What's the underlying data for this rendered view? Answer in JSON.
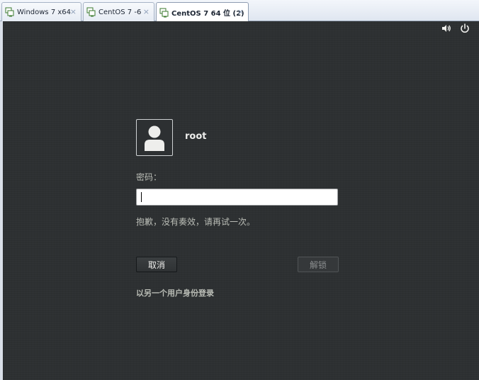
{
  "tabs": [
    {
      "label": "Windows 7 x64",
      "active": false
    },
    {
      "label": "CentOS 7 -6",
      "active": false
    },
    {
      "label": "CentOS 7 64 位 (2)",
      "active": true
    }
  ],
  "tab_close_glyph": "×",
  "topbar": {
    "volume_icon": "volume-icon",
    "power_icon": "power-icon"
  },
  "login": {
    "username": "root",
    "password_label": "密码：",
    "password_value": "",
    "error_message": "抱歉，没有奏效，请再试一次。",
    "cancel_label": "取消",
    "unlock_label": "解锁",
    "other_user_link": "以另一个用户身份登录"
  },
  "colors": {
    "background": "#2d3032",
    "text": "#babdb6",
    "username": "#eeeeec"
  }
}
